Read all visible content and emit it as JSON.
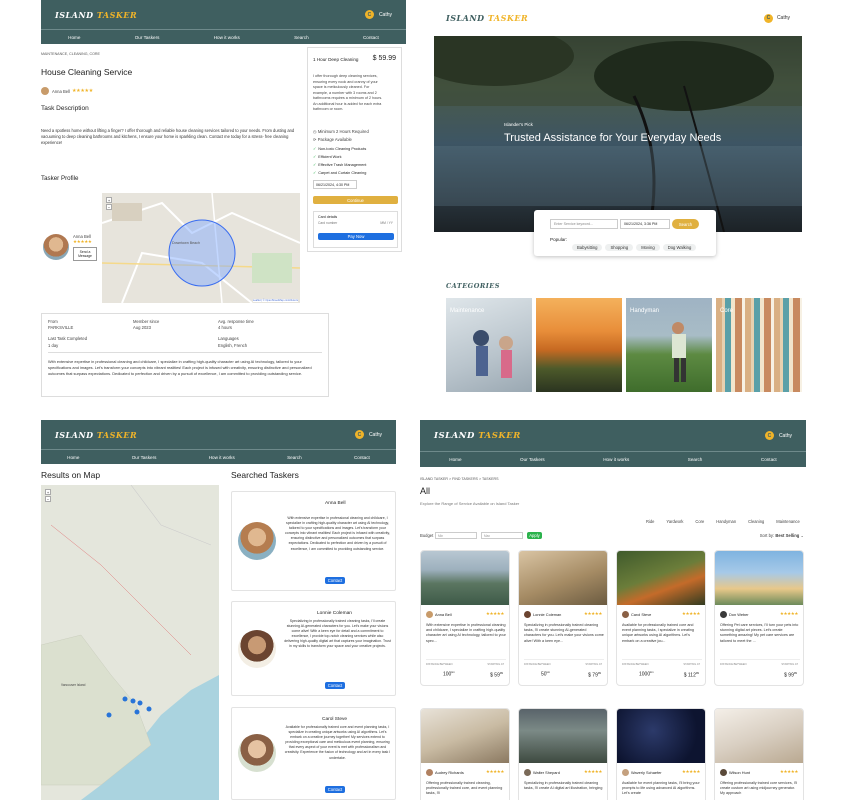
{
  "brand": {
    "part1": "ISLAND",
    "part2": "TASKER"
  },
  "user": {
    "name": "Cathy",
    "initial": "C"
  },
  "nav": [
    "Home",
    "Our Taskers",
    "How it works",
    "Search",
    "Contact"
  ],
  "detail": {
    "breadcrumb": "MAINTENANCE, CLEANING, CORE",
    "title": "House Cleaning Service",
    "tasker_name": "Anna Bell",
    "rating": "★★★★★",
    "desc_heading": "Task Description",
    "desc_text": "Need a spotless home without lifting a finger? I offer thorough and reliable house cleaning services tailored to your needs. From dusting and vacuuming to deep cleaning bathrooms and kitchens, I ensure your home is sparkling clean. Contact me today for a stress- free cleaning experience!",
    "profile_heading": "Tasker Profile",
    "send_message": "Send a Message",
    "map_label": "Downtown Beach",
    "map_credit": "Leaflet | © OpenStreetMap contributors",
    "package_name": "1 Hour Deep Cleaning",
    "price": "$ 59.99",
    "package_desc": "I offer thorough deep cleaning services, ensuring every nook and cranny of your space is meticulously cleaned. For example, a number with 3 rooms and 2 bathrooms requires a minimum of 2 hours. An additional hour is added for each extra bathroom or room.",
    "min_hours": "Minimum 2 Hours Required",
    "package_available": "Package Available",
    "features": [
      "Non-toxic Cleaning Products",
      "Efficient Work",
      "Effective Trash Management",
      "Carpet and Curtain Cleaning"
    ],
    "date_value": "06/21/2024, 4:30 PM",
    "continue_label": "Continue",
    "card_details_label": "Card details",
    "card_number_placeholder": "Card number",
    "card_expiry_placeholder": "MM / YY",
    "pay_label": "Pay Now",
    "info": {
      "from_label": "From",
      "from_value": "PARKSVILLE",
      "member_label": "Member since",
      "member_value": "Aug 2023",
      "response_label": "Avg. response time",
      "response_value": "4 hours",
      "last_task_label": "Last Task Completed",
      "last_task_value": "1 day",
      "languages_label": "Languages",
      "languages_value": "English, French"
    },
    "bio": "With extensive expertise in professional cleaning and childcare, I specialize in crafting high-quality character art using AI technology, tailored to your specifications and images. Let's transform your concepts into vibrant realities! Each project is infused with creativity, ensuring distinctive and personalized outcomes that surpass expectations. Dedicated to perfection and driven by a pursuit of excellence, I am committed to providing outstanding service."
  },
  "home": {
    "kicker": "Islander's Pick",
    "hero_title": "Trusted Assistance for Your Everyday Needs",
    "search_placeholder": "Enter Service keyword...",
    "search_date": "06/21/2024, 3:36 PM",
    "search_button": "Search",
    "popular_label": "Popular:",
    "popular": [
      "Babysitting",
      "Shopping",
      "Moving",
      "Dog Walking"
    ],
    "categories_heading": "CATEGORIES",
    "categories": [
      "Maintenance",
      "",
      "Handyman",
      "Core"
    ]
  },
  "results": {
    "map_heading": "Results on Map",
    "map_city": "Vancouver Island",
    "taskers_heading": "Searched Taskers",
    "taskers": [
      {
        "name": "Anna Bell",
        "text": "With extensive expertise in professional cleaning and childcare, I specialize in crafting high-quality character art using AI technology, tailored to your specifications and images. Let's transform your concepts into vibrant realities! Each project is infused with creativity, ensuring distinctive and personalized outcomes that surpass expectations. Dedicated to perfection and driven by a pursuit of excellence, I am committed to providing outstanding service."
      },
      {
        "name": "Lonnie Coleman",
        "text": "Specializing in professionally trained cleaning tasks, I'll create stunning AI-generated characters for you. Let's make your visions come alive! With a keen eye for detail and a commitment to excellence, I provide top-notch cleaning services while also delivering high-quality digital art that captures your imagination. Trust in my skills to transform your space and your creative projects."
      },
      {
        "name": "Carol Steve",
        "text": "Available for professionally trained core and event planning tasks, I specialize in creating unique artworks using AI algorithms. Let's embark on a creative journey together! My services extend to providing exceptional care and meticulous event planning, ensuring that every aspect of your event is met with professionalism and creativity. Experience the fusion of technology and art in every task I undertake."
      }
    ],
    "contact_label": "Contact"
  },
  "listing": {
    "breadcrumb": "ISLAND TASKER > FIND TASKERS > TASKERS",
    "heading": "All",
    "subheading": "Explore the Range of Service Available on Island Tasker",
    "filters": [
      "Ride",
      "Yardwork",
      "Core",
      "Handyman",
      "Cleaning",
      "Maintenance"
    ],
    "budget_label": "Budget",
    "min_placeholder": "Min",
    "max_placeholder": "Max",
    "apply_label": "Apply",
    "sort_label": "Sort by:",
    "sort_value": "Best Selling",
    "distance_label": "DISTANCE BETWEEN",
    "starting_label": "STARTING AT",
    "cards": [
      {
        "name": "Anna Bell",
        "text": "With extensive expertise in professional cleaning and childcare, I specialize in crafting high-quality character art using AI technology, tailored to your spec...",
        "distance": "100",
        "price": "$ 59",
        "sup": "99"
      },
      {
        "name": "Lonnie Coleman",
        "text": "Specializing in professionally trained cleaning tasks, I'll create stunning AI-generated characters for you. Let's make your visions come alive! With a keen eye...",
        "distance": "50",
        "price": "$ 79",
        "sup": "99"
      },
      {
        "name": "Carol Steve",
        "text": "Available for professionally trained core and event planning tasks, I specialize in creating unique artworks using AI algorithms. Let's embark on a creative jou...",
        "distance": "1000",
        "price": "$ 112",
        "sup": "99"
      },
      {
        "name": "Don Weber",
        "text": "Offering Pet care services, I'll turn your pets into stunning digital art pieces. Let's create something amazing! My pet care services are tailored to meet the ...",
        "distance": "",
        "price": "$ 99",
        "sup": "99"
      },
      {
        "name": "Audrey Richards",
        "text": "Offering professionally trained cleaning, professionally trained core, and event planning tasks, I'll",
        "distance": "",
        "price": "",
        "sup": ""
      },
      {
        "name": "Walter Shepard",
        "text": "Specializing in professionally trained cleaning tasks, I'll create AI digital art illustration, bringing",
        "distance": "",
        "price": "",
        "sup": ""
      },
      {
        "name": "Waverly Schaefer",
        "text": "Available for event planning tasks, I'll bring your prompts to life using advanced AI algorithms. Let's create",
        "distance": "",
        "price": "",
        "sup": ""
      },
      {
        "name": "Wilson Hunt",
        "text": "Offering professionally trained core services, I'll create custom art using midjourney generator. My approach",
        "distance": "",
        "price": "",
        "sup": ""
      }
    ]
  }
}
